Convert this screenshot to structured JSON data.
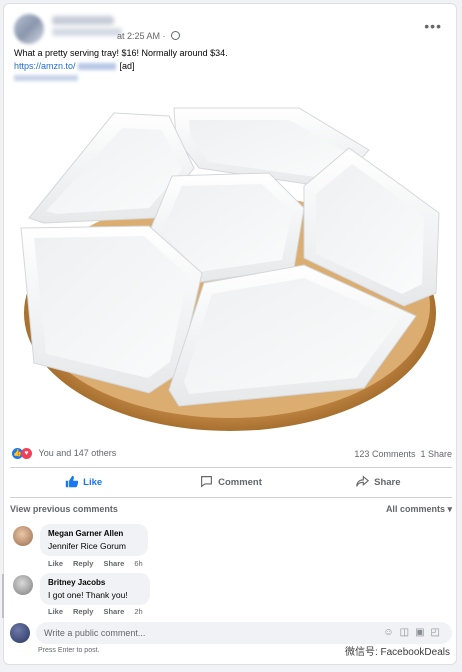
{
  "post": {
    "time": "at 2:25 AM",
    "text_line1": "What a pretty serving tray! $16! Normally around $34.",
    "link_text": "https://amzn.to/",
    "ad_tag": "[ad]"
  },
  "reactions": {
    "summary": "You and 147 others",
    "comments": "123 Comments",
    "shares": "1 Share"
  },
  "actions": {
    "like": "Like",
    "comment": "Comment",
    "share": "Share"
  },
  "comments_header": {
    "view_previous": "View previous comments",
    "filter": "All comments"
  },
  "comments": [
    {
      "name": "Megan Garner Allen",
      "text": "Jennifer Rice Gorum",
      "like": "Like",
      "reply": "Reply",
      "share": "Share",
      "ago": "6h"
    },
    {
      "name": "Britney Jacobs",
      "text": "I got one! Thank you!",
      "like": "Like",
      "reply": "Reply",
      "share": "Share",
      "ago": "2h"
    }
  ],
  "composer": {
    "placeholder": "Write a public comment...",
    "hint": "Press Enter to post."
  },
  "watermark": "微信号: FacebookDeals",
  "icons": [
    "more-icon",
    "globe-icon",
    "like-reaction-icon",
    "love-reaction-icon",
    "thumbs-up-icon",
    "comment-icon",
    "share-icon",
    "emoji-icon",
    "camera-icon",
    "gif-icon",
    "sticker-icon"
  ],
  "colors": {
    "accent": "#1877f2",
    "love": "#f33e58",
    "bubble": "#f0f2f5"
  }
}
